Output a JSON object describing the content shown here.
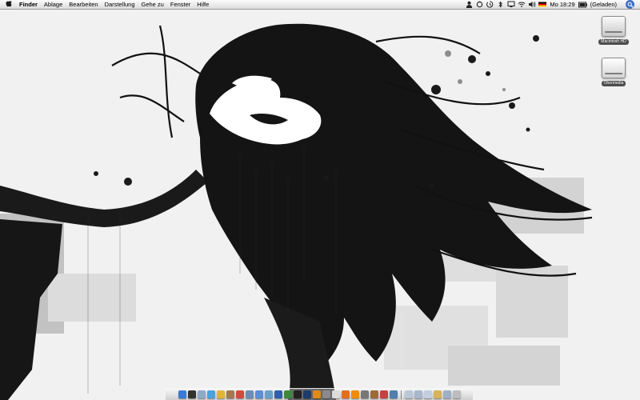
{
  "menubar": {
    "apple_icon": "apple-icon",
    "items": [
      "Finder",
      "Ablage",
      "Bearbeiten",
      "Darstellung",
      "Gehe zu",
      "Fenster",
      "Hilfe"
    ],
    "status": {
      "clock": "Mo 18:29",
      "battery_text": "(Geladen)",
      "icons": [
        "user-icon",
        "sync-icon",
        "time-machine-icon",
        "wifi-icon",
        "volume-icon",
        "german-flag-icon",
        "battery-icon",
        "spotlight-icon"
      ]
    }
  },
  "desktop": {
    "icons": [
      {
        "label": "Macintosh HD",
        "icon": "hard-drive-icon"
      },
      {
        "label": "Ohermedia",
        "icon": "usb-drive-icon"
      }
    ]
  },
  "dock": {
    "apps": [
      {
        "name": "finder-icon",
        "color": "#3a7bd5"
      },
      {
        "name": "dashboard-icon",
        "color": "#333333"
      },
      {
        "name": "mail-icon",
        "color": "#8fa9c9"
      },
      {
        "name": "safari-icon",
        "color": "#4aa3df"
      },
      {
        "name": "ichat-icon",
        "color": "#e0b43a"
      },
      {
        "name": "address-book-icon",
        "color": "#a07a4a"
      },
      {
        "name": "ical-icon",
        "color": "#d24a3a"
      },
      {
        "name": "preview-icon",
        "color": "#6c8db5"
      },
      {
        "name": "itunes-icon",
        "color": "#5b8fd6"
      },
      {
        "name": "iphoto-icon",
        "color": "#6aa0c8"
      },
      {
        "name": "word-icon",
        "color": "#2f5fa8"
      },
      {
        "name": "excel-icon",
        "color": "#3c8a3c"
      },
      {
        "name": "terminal-icon",
        "color": "#222222"
      },
      {
        "name": "photoshop-icon",
        "color": "#1f3b6d"
      },
      {
        "name": "illustrator-icon",
        "color": "#e08a1a"
      },
      {
        "name": "system-preferences-icon",
        "color": "#8a8a8a"
      },
      {
        "name": "textedit-icon",
        "color": "#dcdcdc"
      },
      {
        "name": "firefox-icon",
        "color": "#e07020"
      },
      {
        "name": "vlc-icon",
        "color": "#f08c00"
      },
      {
        "name": "utility-icon",
        "color": "#777777"
      },
      {
        "name": "app-icon",
        "color": "#9d6b3a"
      },
      {
        "name": "app-icon-2",
        "color": "#c94040"
      },
      {
        "name": "app-icon-3",
        "color": "#4f7fae"
      }
    ],
    "trailing": [
      {
        "name": "documents-folder-icon",
        "color": "#b9c7d8"
      },
      {
        "name": "downloads-folder-icon",
        "color": "#a8b8cc"
      },
      {
        "name": "applications-folder-icon",
        "color": "#c2cfe0"
      },
      {
        "name": "image-stack-icon",
        "color": "#d7b35a"
      },
      {
        "name": "folder-stack-icon",
        "color": "#9fb0c6"
      },
      {
        "name": "trash-icon",
        "color": "#bdbdbd"
      }
    ]
  }
}
